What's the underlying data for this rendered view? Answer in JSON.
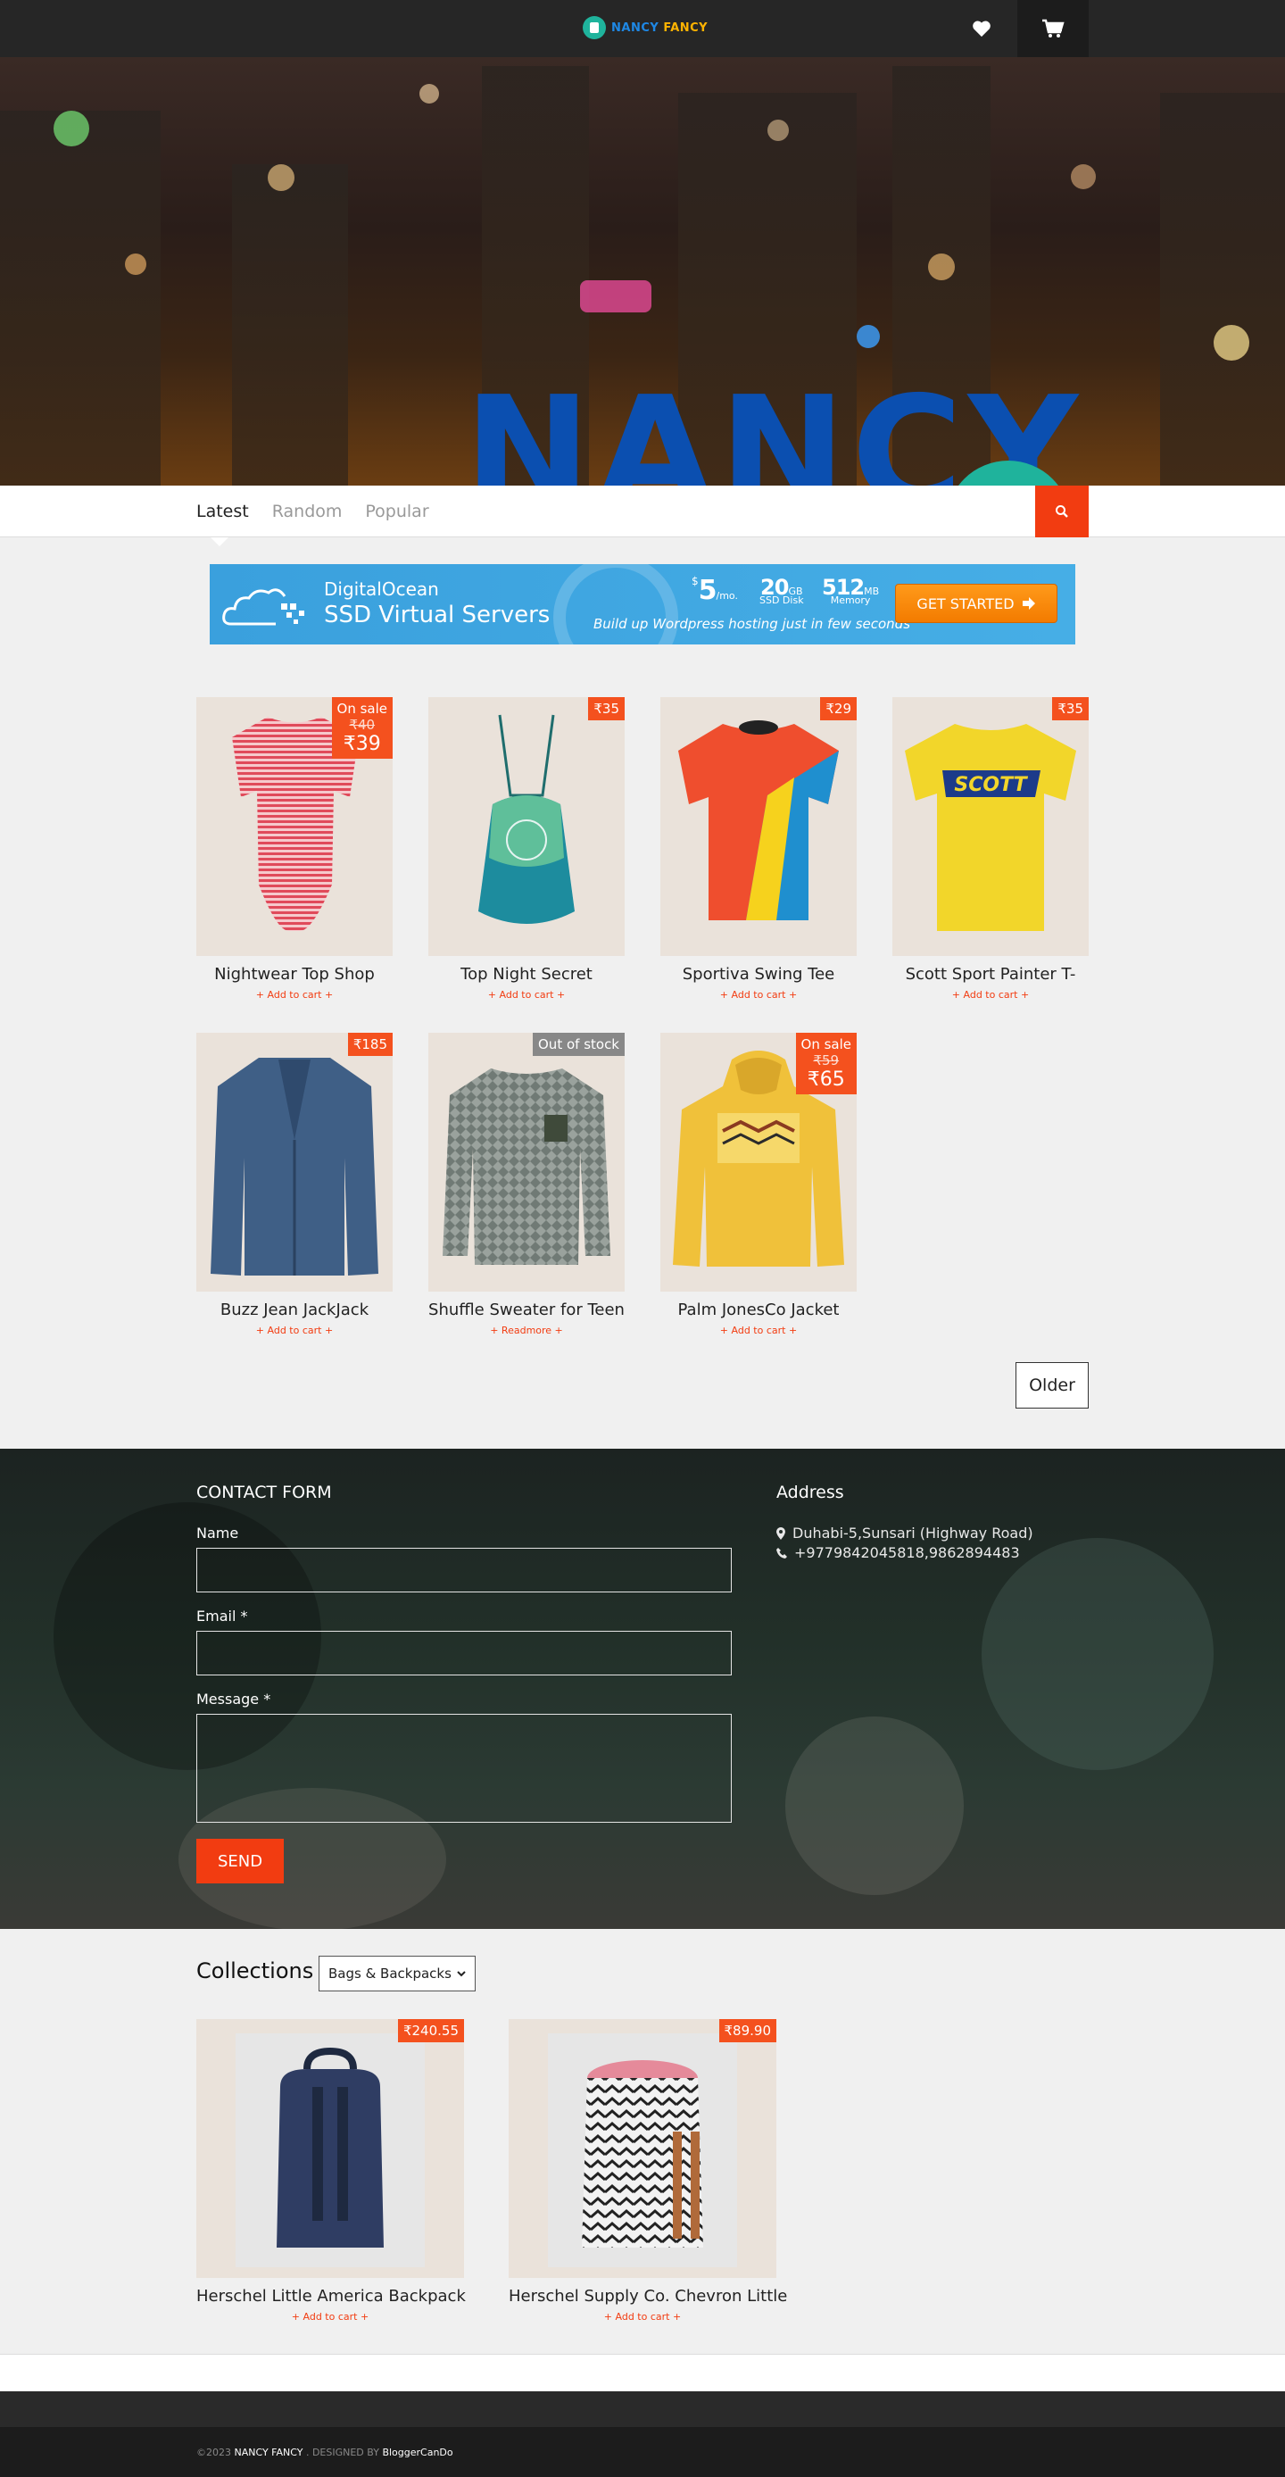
{
  "header": {
    "logo_part1": "NANCY",
    "logo_part2": "FANCY"
  },
  "hero": {
    "title": "NANCY"
  },
  "tabs": [
    {
      "label": "Latest"
    },
    {
      "label": "Random"
    },
    {
      "label": "Popular"
    }
  ],
  "ad": {
    "brand": "DigitalOcean",
    "subtitle": "SSD Virtual Servers",
    "price": "5",
    "price_unit": "/mo.",
    "disk_value": "20",
    "disk_unit": "GB",
    "disk_label": "SSD Disk",
    "memory_value": "512",
    "memory_unit": "MB",
    "memory_label": "Memory",
    "tagline": "Build up Wordpress hosting just in few seconds",
    "cta": "GET STARTED"
  },
  "products": [
    {
      "name": "Nightwear Top Shop",
      "cta": "+ Add to cart +",
      "badge_status": "On sale",
      "badge_old": "₹40",
      "badge_new": "₹39"
    },
    {
      "name": "Top Night Secret",
      "cta": "+ Add to cart +",
      "badge_price": "₹35"
    },
    {
      "name": "Sportiva Swing Tee",
      "cta": "+ Add to cart +",
      "badge_price": "₹29"
    },
    {
      "name": "Scott Sport Painter T-",
      "cta": "+ Add to cart +",
      "badge_price": "₹35",
      "print_text": "SCOTT"
    },
    {
      "name": "Buzz Jean JackJack",
      "cta": "+ Add to cart +",
      "badge_price": "₹185"
    },
    {
      "name": "Shuffle Sweater for Teen",
      "cta": "+ Readmore +",
      "badge_status": "Out of stock"
    },
    {
      "name": "Palm JonesCo Jacket",
      "cta": "+ Add to cart +",
      "badge_status": "On sale",
      "badge_old": "₹59",
      "badge_new": "₹65"
    }
  ],
  "pagination": {
    "older": "Older"
  },
  "contact": {
    "title": "CONTACT FORM",
    "name_label": "Name",
    "email_label": "Email",
    "message_label": "Message",
    "required_mark": "*",
    "send": "SEND"
  },
  "address": {
    "title": "Address",
    "location": "Duhabi-5,Sunsari (Highway Road)",
    "phone": "+9779842045818,9862894483"
  },
  "collections": {
    "title": "Collections",
    "selected": "Bags & Backpacks",
    "items": [
      {
        "name": "Herschel Little America Backpack",
        "price": "₹240.55",
        "cta": "+ Add to cart +"
      },
      {
        "name": "Herschel Supply Co. Chevron Little",
        "price": "₹89.90",
        "cta": "+ Add to cart +"
      }
    ]
  },
  "footer": {
    "copyright": "©2023",
    "site": "NANCY FANCY",
    "designed_by": ". DESIGNED BY",
    "designer": "BloggerCanDo"
  },
  "colors": {
    "accent": "#f23c11",
    "badge": "#f4511e",
    "brand_blue": "#0b4fb0",
    "brand_teal": "#1fb39c"
  }
}
